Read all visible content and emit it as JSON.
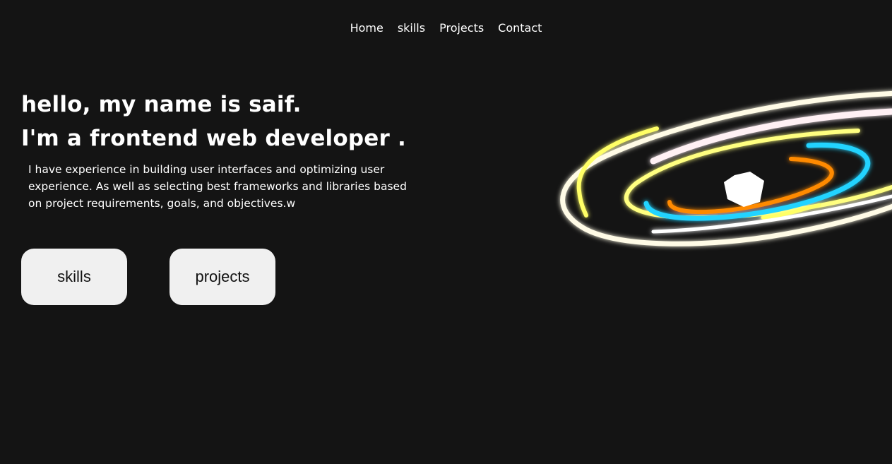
{
  "nav": {
    "items": [
      {
        "label": "Home"
      },
      {
        "label": "skills"
      },
      {
        "label": "Projects"
      },
      {
        "label": "Contact"
      }
    ]
  },
  "hero": {
    "line1": "hello, my name is saif.",
    "line2": "I'm a frontend web developer .",
    "description": "I have experience in building user interfaces and optimizing user experience. As well as selecting best frameworks and libraries based on project requirements, goals, and objectives.w"
  },
  "buttons": {
    "skills": "skills",
    "projects": "projects"
  },
  "colors": {
    "background": "#141414",
    "button_bg": "#f0f0f0",
    "ring_yellow": "#ffff66",
    "ring_cyan": "#22d3ff",
    "ring_orange": "#ff8a00",
    "ring_white": "#fff6f6"
  },
  "graphic": {
    "icon": "glowing-rings-hexagon-animation"
  }
}
